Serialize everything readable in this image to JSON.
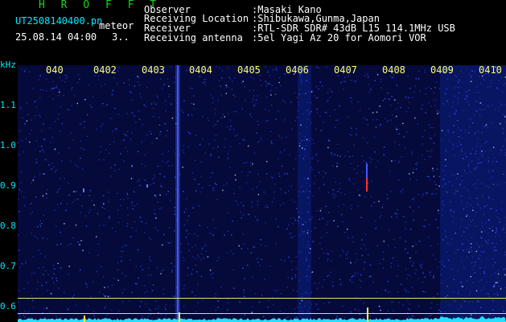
{
  "header": {
    "logo": "H R O F F T",
    "filename": "UT2508140400.pn",
    "meteor_label": "meteor",
    "datetime": "25.08.14 04:00",
    "count": "3.."
  },
  "info": [
    {
      "label": "Observer",
      "value": ":Masaki Kano"
    },
    {
      "label": "Receiving Location",
      "value": ":Shibukawa,Gunma,Japan"
    },
    {
      "label": "Receiver",
      "value": ":RTL-SDR SDR# 43dB L15 114.1MHz USB"
    },
    {
      "label": "Receiving antenna",
      "value": ":5el Yagi Az 20 for Aomori VOR"
    }
  ],
  "y_axis": {
    "unit": "kHz",
    "ticks": [
      "1.1",
      "1.0",
      "0.9",
      "0.8",
      "0.7",
      "0.6"
    ]
  },
  "x_axis": {
    "ticks": [
      "040",
      "0402",
      "0403",
      "0404",
      "0405",
      "0406",
      "0407",
      "0408",
      "0409",
      "0410"
    ]
  },
  "colors": {
    "background": "#000000",
    "text_cyan": "#00e8ff",
    "logo_green": "#19d219",
    "tick_yellow": "#ffff66",
    "noise_blue": "#1c2fd0",
    "trace_cyan": "#22e0ff",
    "meteor_red": "#ff3030"
  }
}
